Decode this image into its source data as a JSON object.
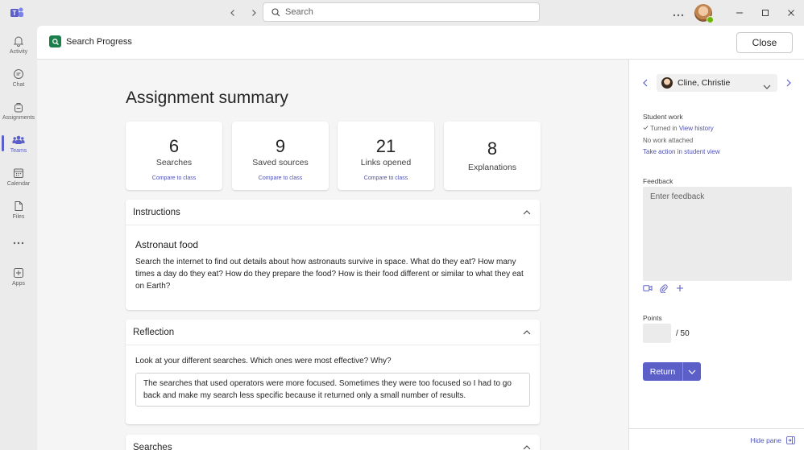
{
  "titlebar": {
    "search_placeholder": "Search",
    "icons": {
      "back": "chevron-left-icon",
      "forward": "chevron-right-icon",
      "more": "more-icon",
      "minimize": "minimize-icon",
      "maximize": "maximize-icon",
      "close": "close-icon"
    }
  },
  "rail": {
    "items": [
      {
        "label": "Activity",
        "icon": "bell-icon"
      },
      {
        "label": "Chat",
        "icon": "chat-icon"
      },
      {
        "label": "Assignments",
        "icon": "backpack-icon"
      },
      {
        "label": "Teams",
        "icon": "teams-icon",
        "active": true
      },
      {
        "label": "Calendar",
        "icon": "calendar-icon"
      },
      {
        "label": "Files",
        "icon": "file-icon"
      },
      {
        "label": "",
        "icon": "more-icon"
      },
      {
        "label": "Apps",
        "icon": "add-app-icon"
      }
    ]
  },
  "header": {
    "app_title": "Search Progress",
    "close_label": "Close"
  },
  "summary": {
    "title": "Assignment summary",
    "stats": [
      {
        "value": "6",
        "label": "Searches",
        "link": "Compare to class"
      },
      {
        "value": "9",
        "label": "Saved sources",
        "link": "Compare to class"
      },
      {
        "value": "21",
        "label": "Links opened",
        "link": "Compare to class"
      },
      {
        "value": "8",
        "label": "Explanations",
        "link": ""
      }
    ]
  },
  "instructions": {
    "heading": "Instructions",
    "subtitle": "Astronaut food",
    "text": "Search the internet to find out details about how astronauts survive in space. What do they eat? How many times a day do they eat? How do they prepare the food? How is their food different or similar to what they eat on Earth?"
  },
  "reflection": {
    "heading": "Reflection",
    "question": "Look at your different searches. Which ones were most effective? Why?",
    "answer": "The searches that used operators were more focused. Sometimes they were too focused so I had to go back and make my search less specific because it returned only a small number of results."
  },
  "searches": {
    "heading": "Searches"
  },
  "pane": {
    "student_name": "Cline, Christie",
    "student_work_label": "Student work",
    "turned_in": "Turned in",
    "view_history": "View history",
    "no_work": "No work attached",
    "take_action": "Take action in student view",
    "feedback_label": "Feedback",
    "feedback_placeholder": "Enter feedback",
    "points_label": "Points",
    "points_max": "/ 50",
    "return_label": "Return",
    "hide_pane": "Hide pane"
  },
  "colors": {
    "accent": "#5b5fc7",
    "link": "#4f52b2",
    "app_icon": "#1a7f4b",
    "presence": "#6bb700"
  }
}
